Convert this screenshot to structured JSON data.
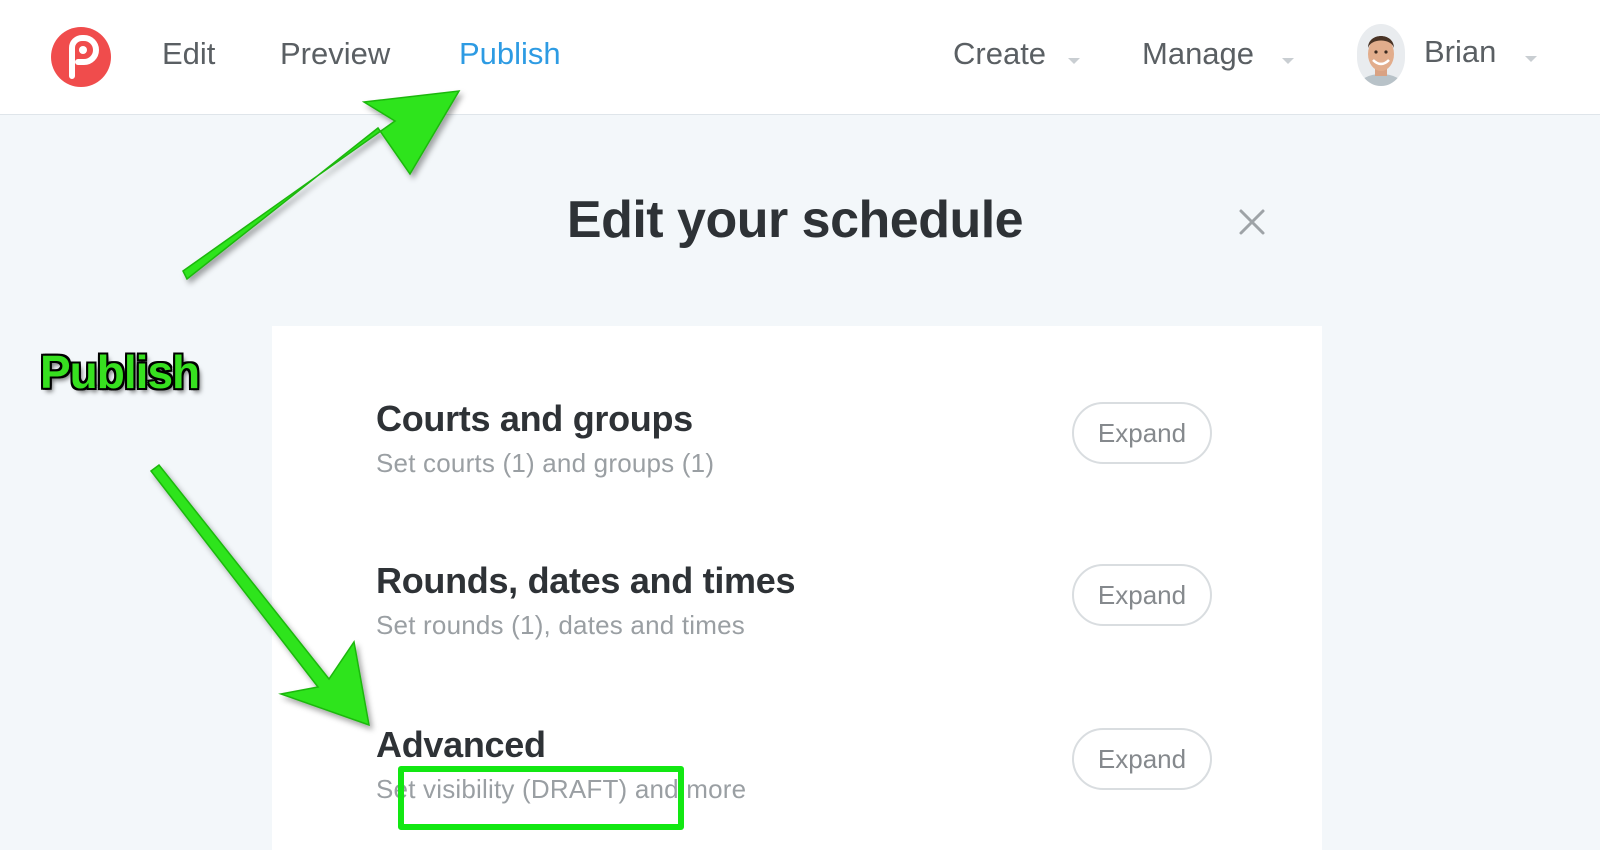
{
  "nav": {
    "logo_icon": "brand-p-logo-icon",
    "edit": "Edit",
    "preview": "Preview",
    "publish": "Publish",
    "create": "Create",
    "manage": "Manage",
    "user": "Brian"
  },
  "page": {
    "title": "Edit your schedule",
    "close_icon": "close-icon"
  },
  "sections": [
    {
      "title": "Courts and groups",
      "subtitle": "Set courts (1) and groups (1)",
      "button": "Expand"
    },
    {
      "title": "Rounds, dates and times",
      "subtitle": "Set rounds (1), dates and times",
      "button": "Expand"
    },
    {
      "title": "Advanced",
      "subtitle": "Set visibility (DRAFT) and more",
      "button": "Expand"
    }
  ],
  "annotation": {
    "label": "Publish"
  },
  "colors": {
    "accent": "#2d9be3",
    "brand": "#f04c4c",
    "annotation_green": "#12e812",
    "background": "#f3f7fa"
  }
}
